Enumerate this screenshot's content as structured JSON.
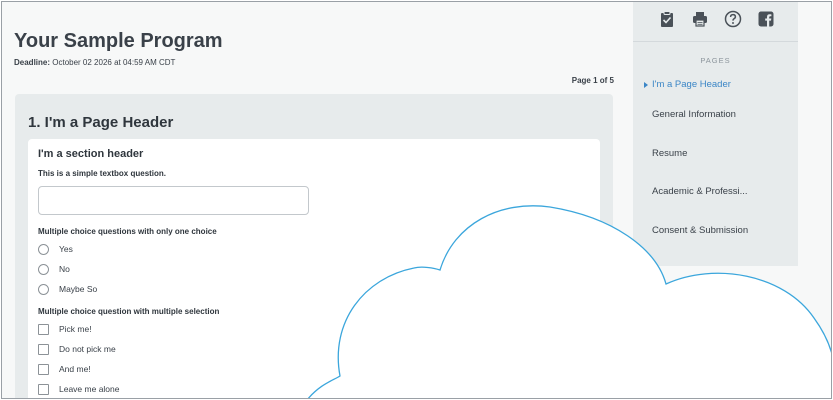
{
  "program": {
    "title": "Your Sample Program",
    "deadline_label": "Deadline:",
    "deadline_value": "October 02 2026 at 04:59 AM CDT",
    "page_count": "Page 1 of 5"
  },
  "page": {
    "header": "1. I'm a Page Header",
    "section": {
      "header": "I'm a section header",
      "textbox_question": "This is a simple textbox question.",
      "single_choice": {
        "question": "Multiple choice questions with only one choice",
        "options": [
          "Yes",
          "No",
          "Maybe So"
        ]
      },
      "multi_choice": {
        "question": "Multiple choice question with multiple selection",
        "options": [
          "Pick me!",
          "Do not pick me",
          "And me!",
          "Leave me alone"
        ]
      }
    }
  },
  "sidebar": {
    "tools": [
      "checklist-icon",
      "print-icon",
      "help-icon",
      "facebook-icon"
    ],
    "pages_title": "PAGES",
    "pages": [
      "I'm a Page Header",
      "General Information",
      "Resume",
      "Academic & Professi...",
      "Consent & Submission"
    ],
    "active_page": 0
  },
  "colors": {
    "accent": "#3b86c6",
    "cloud_stroke": "#3ba6dc",
    "panel": "#e7ebec"
  }
}
